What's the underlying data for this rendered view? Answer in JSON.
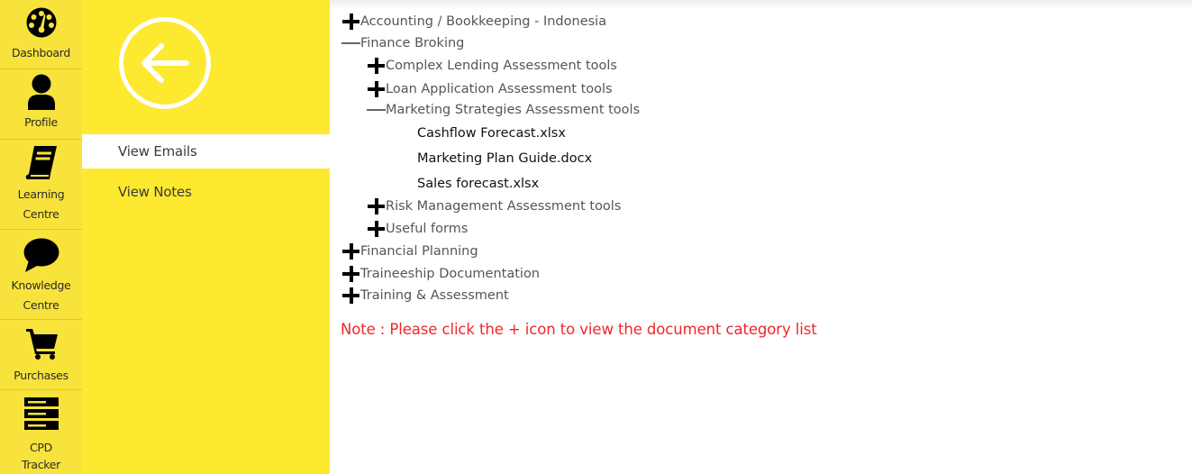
{
  "rail": {
    "items": [
      {
        "label": "Dashboard",
        "icon": "dashboard-icon"
      },
      {
        "label": "Profile",
        "icon": "user-icon"
      },
      {
        "label_line1": "Learning",
        "label_line2": "Centre",
        "icon": "book-icon"
      },
      {
        "label_line1": "Knowledge",
        "label_line2": "Centre",
        "icon": "chat-bubble-icon"
      },
      {
        "label": "Purchases",
        "icon": "cart-icon"
      },
      {
        "label_line1": "CPD",
        "label_line2": "Tracker",
        "icon": "server-icon"
      }
    ]
  },
  "panel": {
    "back_icon": "arrow-left-circle-icon",
    "menu": [
      {
        "label": "View Emails",
        "active": true
      },
      {
        "label": "View Notes",
        "active": false
      }
    ]
  },
  "tree": {
    "nodes": [
      {
        "label": "Accounting / Bookkeeping - Indonesia",
        "toggle": "plus"
      },
      {
        "label": "Finance Broking",
        "toggle": "minus"
      },
      {
        "label": "Complex Lending Assessment tools",
        "toggle": "plus"
      },
      {
        "label": "Loan Application Assessment tools",
        "toggle": "plus"
      },
      {
        "label": "Marketing Strategies Assessment tools",
        "toggle": "minus"
      },
      {
        "label": "Cashflow Forecast.xlsx",
        "toggle": "none"
      },
      {
        "label": "Marketing Plan Guide.docx",
        "toggle": "none"
      },
      {
        "label": "Sales forecast.xlsx",
        "toggle": "none"
      },
      {
        "label": "Risk Management Assessment tools",
        "toggle": "plus"
      },
      {
        "label": "Useful forms",
        "toggle": "plus"
      },
      {
        "label": "Financial Planning",
        "toggle": "plus"
      },
      {
        "label": "Traineeship Documentation",
        "toggle": "plus"
      },
      {
        "label": "Training & Assessment",
        "toggle": "plus"
      }
    ]
  },
  "note": "Note : Please click the + icon to view the document category list",
  "colors": {
    "rail_bg": "#f7e33b",
    "panel_bg": "#fde92f",
    "note_red": "#f0262a"
  }
}
